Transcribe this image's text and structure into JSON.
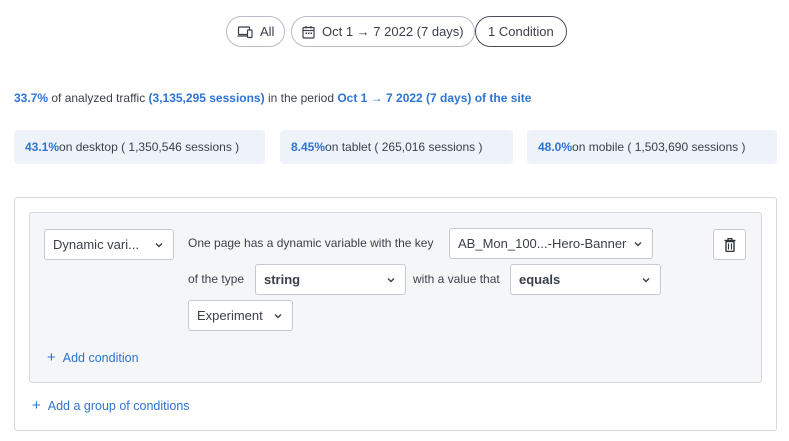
{
  "filters": {
    "device_label": "All",
    "date_label": "Oct 1 → 7 2022 (7 days)",
    "condition_label": "1 Condition"
  },
  "summary": {
    "share": "33.7%",
    "text1": " of analyzed traffic ",
    "sessions": "(3,135,295 sessions)",
    "text2": " in the period ",
    "period": "Oct 1 → 7 2022 (7 days) of the site"
  },
  "devices": [
    {
      "pct": "43.1%",
      "text": " on desktop ( 1,350,546 sessions )"
    },
    {
      "pct": "8.45%",
      "text": " on tablet ( 265,016 sessions )"
    },
    {
      "pct": "48.0%",
      "text": " on mobile ( 1,503,690 sessions )"
    }
  ],
  "condition": {
    "type_select": "Dynamic vari...",
    "sentence1": "One page has a dynamic variable with the key",
    "key_value": "AB_Mon_100...-Hero-Banner",
    "sentence2": "of the type",
    "type_value": "string",
    "sentence3": "with a value that",
    "operator_value": "equals",
    "value_select": "Experiment",
    "add_condition": "Add condition",
    "add_group": "Add a group of conditions"
  },
  "colors": {
    "accent": "#2d74d3",
    "card_bg": "#eef2f9",
    "group_bg": "#f5f6f8"
  }
}
